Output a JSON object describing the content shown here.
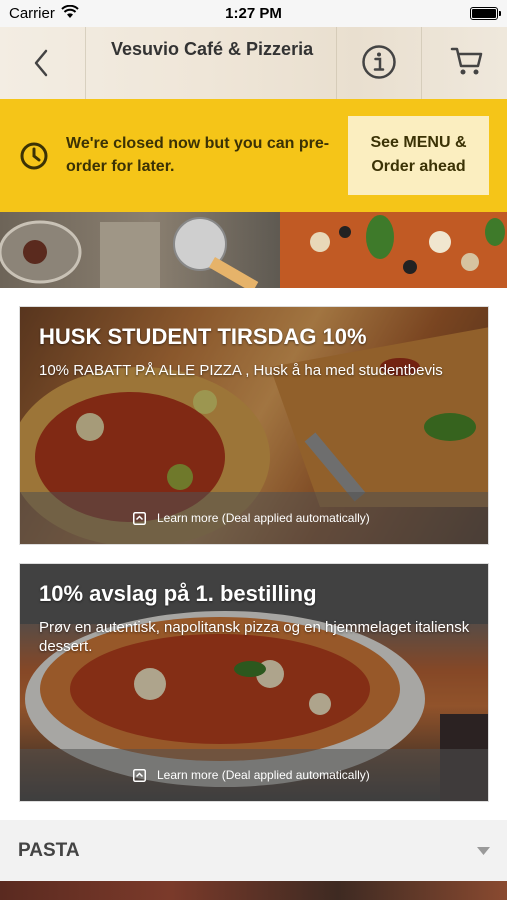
{
  "status_bar": {
    "carrier": "Carrier",
    "time": "1:27 PM"
  },
  "header": {
    "title": "Vesuvio Café & Pizzeria"
  },
  "banner": {
    "message": "We're closed now but you can pre-order for later.",
    "cta": "See MENU & Order ahead"
  },
  "deals": [
    {
      "title": "HUSK STUDENT TIRSDAG 10%",
      "description": "10% RABATT PÅ ALLE PIZZA , Husk å ha med studentbevis",
      "footer": "Learn more (Deal applied automatically)"
    },
    {
      "title": "10% avslag på 1. bestilling",
      "description": "Prøv en autentisk, napolitansk pizza og en hjemmelaget italiensk dessert.",
      "footer": "Learn more (Deal applied automatically)"
    }
  ],
  "category": {
    "label": "PASTA"
  },
  "colors": {
    "banner": "#f5c518",
    "cta_bg": "#fbeec0",
    "banner_text": "#3b3205"
  }
}
